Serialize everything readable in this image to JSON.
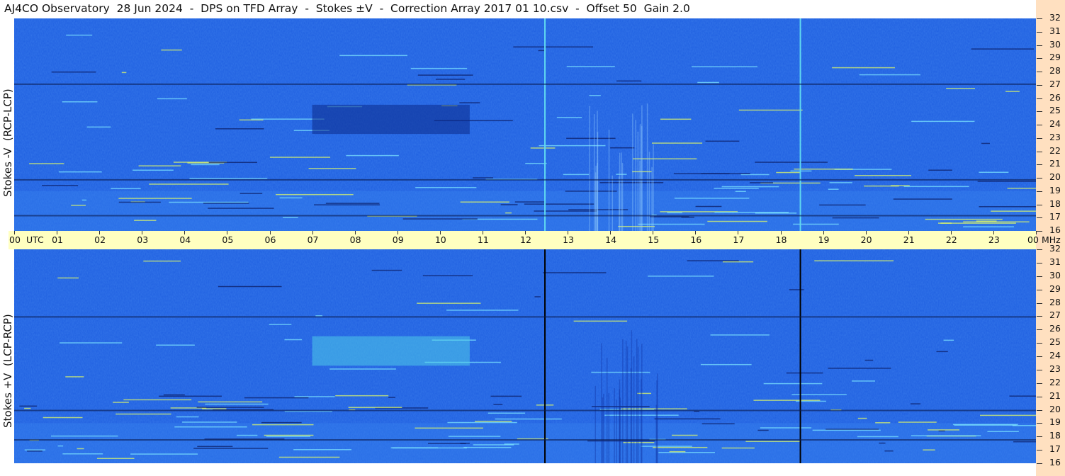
{
  "header": {
    "title": "AJ4CO Observatory  28 Jun 2024  -  DPS on TFD Array  -  Stokes ±V  -  Correction Array 2017 01 10.csv  -  Offset 50  Gain 2.0"
  },
  "colors": {
    "background": "#1e5ee0",
    "time_bar": "#ffffc0",
    "freq_axis_bg": "#ffe0c0"
  },
  "chart_data": [
    {
      "type": "heatmap",
      "ylabel": "Stokes -V  (RCP-LCP)",
      "x_ticks": [
        "00",
        "01",
        "02",
        "03",
        "04",
        "05",
        "06",
        "07",
        "08",
        "09",
        "10",
        "11",
        "12",
        "13",
        "14",
        "15",
        "16",
        "17",
        "18",
        "19",
        "20",
        "21",
        "22",
        "23",
        "00"
      ],
      "x_unit": "UTC",
      "y_ticks": [
        "16",
        "17",
        "18",
        "19",
        "20",
        "21",
        "22",
        "23",
        "24",
        "25",
        "26",
        "27",
        "28",
        "29",
        "30",
        "31",
        "32"
      ],
      "y_unit": "MHz",
      "ylim": [
        16,
        32
      ],
      "xlim": [
        0,
        24
      ],
      "features": [
        {
          "kind": "dark band",
          "t_start": 7.0,
          "t_end": 10.7,
          "f_low": 23.3,
          "f_high": 25.5
        },
        {
          "kind": "vertical line",
          "t": 12.45
        },
        {
          "kind": "vertical line",
          "t": 18.45
        },
        {
          "kind": "horizontal line",
          "f": 17.2
        },
        {
          "kind": "horizontal line",
          "f": 19.9
        },
        {
          "kind": "horizontal line",
          "f": 27.1
        }
      ]
    },
    {
      "type": "heatmap",
      "ylabel": "Stokes +V  (LCP-RCP)",
      "x_ticks": [
        "00",
        "01",
        "02",
        "03",
        "04",
        "05",
        "06",
        "07",
        "08",
        "09",
        "10",
        "11",
        "12",
        "13",
        "14",
        "15",
        "16",
        "17",
        "18",
        "19",
        "20",
        "21",
        "22",
        "23",
        "00"
      ],
      "x_unit": "UTC",
      "y_ticks": [
        "16",
        "17",
        "18",
        "19",
        "20",
        "21",
        "22",
        "23",
        "24",
        "25",
        "26",
        "27",
        "28",
        "29",
        "30",
        "31",
        "32"
      ],
      "y_unit": "MHz",
      "ylim": [
        16,
        32
      ],
      "xlim": [
        0,
        24
      ],
      "features": [
        {
          "kind": "bright band",
          "t_start": 7.0,
          "t_end": 10.7,
          "f_low": 23.3,
          "f_high": 25.5
        },
        {
          "kind": "vertical line",
          "t": 12.45
        },
        {
          "kind": "vertical line",
          "t": 18.45
        },
        {
          "kind": "horizontal line",
          "f": 17.8
        },
        {
          "kind": "horizontal line",
          "f": 20.0
        },
        {
          "kind": "horizontal line",
          "f": 27.0
        }
      ]
    }
  ]
}
